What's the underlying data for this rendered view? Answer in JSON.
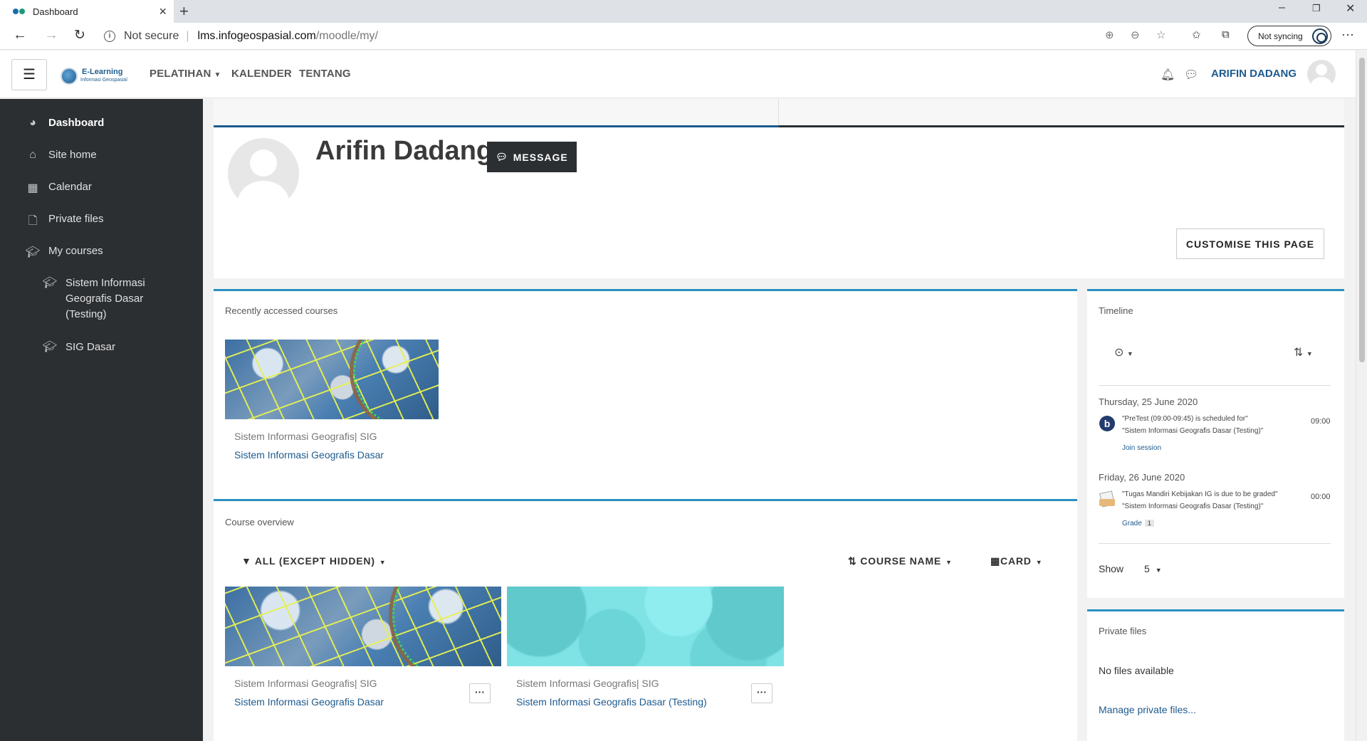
{
  "browser": {
    "tab_title": "Dashboard",
    "not_secure": "Not secure",
    "url_host": "lms.infogeospasial.com",
    "url_path": "/moodle/my/",
    "sync_label": "Not syncing"
  },
  "navbar": {
    "logo_line1": "E-Learning",
    "logo_line2": "Informasi Geospasial",
    "menu": [
      "PELATIHAN",
      "KALENDER",
      "TENTANG"
    ],
    "username": "ARIFIN DADANG"
  },
  "sidebar": {
    "items": [
      {
        "label": "Dashboard",
        "icon": "dashboard-icon"
      },
      {
        "label": "Site home",
        "icon": "home-icon"
      },
      {
        "label": "Calendar",
        "icon": "calendar-icon"
      },
      {
        "label": "Private files",
        "icon": "file-icon"
      },
      {
        "label": "My courses",
        "icon": "graduation-cap-icon"
      }
    ],
    "courses": [
      {
        "label": "Sistem Informasi Geografis Dasar (Testing)",
        "lines": [
          "Sistem Informasi",
          "Geografis Dasar",
          "(Testing)"
        ]
      },
      {
        "label": "SIG Dasar",
        "lines": [
          "SIG Dasar"
        ]
      }
    ]
  },
  "profile": {
    "name": "Arifin Dadang",
    "message_button": "MESSAGE",
    "customise_button": "CUSTOMISE THIS PAGE"
  },
  "recent": {
    "title": "Recently accessed courses",
    "courses": [
      {
        "category": "Sistem Informasi Geografis| SIG",
        "name": "Sistem Informasi Geografis Dasar"
      }
    ]
  },
  "overview": {
    "title": "Course overview",
    "filter_label": "ALL (EXCEPT HIDDEN)",
    "sort_label": "COURSE NAME",
    "view_label": "CARD",
    "courses": [
      {
        "category": "Sistem Informasi Geografis| SIG",
        "name": "Sistem Informasi Geografis Dasar"
      },
      {
        "category": "Sistem Informasi Geografis| SIG",
        "name": "Sistem Informasi Geografis Dasar (Testing)"
      }
    ]
  },
  "timeline": {
    "title": "Timeline",
    "events": [
      {
        "date": "Thursday, 25 June 2020",
        "line1": "\"PreTest (09:00-09:45) is scheduled for\"",
        "line2": "\"Sistem Informasi Geografis Dasar (Testing)\"",
        "time": "09:00",
        "action": "Join session"
      },
      {
        "date": "Friday, 26 June 2020",
        "line1": "\"Tugas Mandiri Kebijakan IG is due to be graded\"",
        "line2": "\"Sistem Informasi Geografis Dasar (Testing)\"",
        "time": "00:00",
        "action": "Grade",
        "badge": "1"
      }
    ],
    "show_label": "Show",
    "show_value": "5"
  },
  "private_files": {
    "title": "Private files",
    "empty_text": "No files available",
    "manage_link": "Manage private files..."
  }
}
